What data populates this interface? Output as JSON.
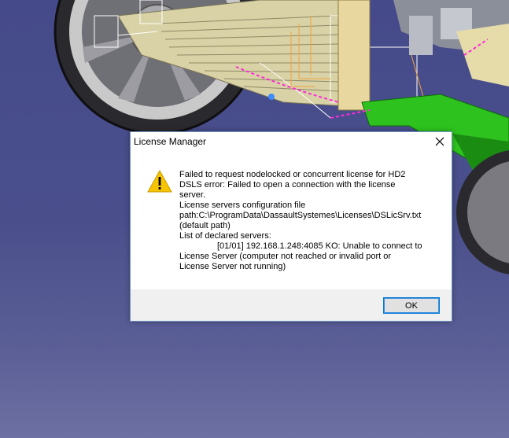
{
  "dialog": {
    "title": "License Manager",
    "icon": "warning-icon",
    "message_lines": [
      "Failed to request nodelocked or concurrent license for HD2",
      "DSLS error: Failed to open a connection with the license",
      "server.",
      "License servers configuration file",
      "path:C:\\ProgramData\\DassaultSystemes\\Licenses\\DSLicSrv.txt",
      "(default path)",
      "List of declared servers:",
      "[01/01] 192.168.1.248:4085 KO: Unable to connect to",
      "License Server (computer not reached or invalid port or",
      "License Server not running)"
    ],
    "ok_label": "OK",
    "close_glyph": "✕"
  },
  "colors": {
    "viewport_background": "#4a4f8c",
    "dialog_border": "#6f93c2",
    "button_border": "#0078d7",
    "warning_yellow": "#f7c400"
  }
}
